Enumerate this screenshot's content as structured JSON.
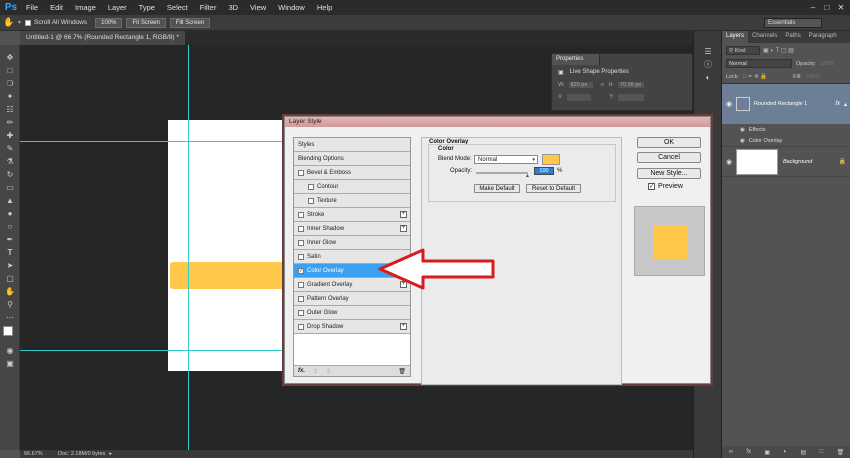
{
  "menubar": {
    "logo": "Ps",
    "items": [
      "File",
      "Edit",
      "Image",
      "Layer",
      "Type",
      "Select",
      "Filter",
      "3D",
      "View",
      "Window",
      "Help"
    ]
  },
  "options": {
    "scroll_all": "Scroll All Windows",
    "zoom100": "100%",
    "fit": "Fit Screen",
    "fill": "Fill Screen",
    "workspace": "Essentials"
  },
  "document": {
    "tab": "Untitled-1 @ 66.7% (Rounded Rectangle 1, RGB/8) *",
    "zoom": "66.67%",
    "doc_info": "Doc: 2.18M/0 bytes"
  },
  "properties": {
    "tab": "Properties",
    "title": "Live Shape Properties",
    "w_label": "W:",
    "w_value": "820 px",
    "h_label": "H:",
    "h_value": "70.99 px",
    "x_label": "X:",
    "x_value": "",
    "y_label": "Y:",
    "y_value": ""
  },
  "layers": {
    "tabs": [
      "Layers",
      "Channels",
      "Paths",
      "Paragraph"
    ],
    "kind": "Kind",
    "blend": "Normal",
    "opacity_label": "Opacity:",
    "opacity": "100%",
    "lock_label": "Lock:",
    "fill_label": "Fill:",
    "fill": "100%",
    "rows": [
      {
        "name": "Rounded Rectangle 1",
        "fx": "fx"
      },
      {
        "name": "Effects"
      },
      {
        "name": "Color Overlay"
      },
      {
        "name": "Background"
      }
    ]
  },
  "dialog": {
    "title": "Layer Style",
    "styles": [
      {
        "label": "Styles",
        "check": false,
        "plus": false,
        "indent": 0
      },
      {
        "label": "Blending Options",
        "check": false,
        "plus": false,
        "indent": 0
      },
      {
        "label": "Bevel & Emboss",
        "check": true,
        "plus": false,
        "indent": 0
      },
      {
        "label": "Contour",
        "check": true,
        "plus": false,
        "indent": 1
      },
      {
        "label": "Texture",
        "check": true,
        "plus": false,
        "indent": 1
      },
      {
        "label": "Stroke",
        "check": true,
        "plus": true,
        "indent": 0
      },
      {
        "label": "Inner Shadow",
        "check": true,
        "plus": true,
        "indent": 0
      },
      {
        "label": "Inner Glow",
        "check": true,
        "plus": false,
        "indent": 0
      },
      {
        "label": "Satin",
        "check": true,
        "plus": false,
        "indent": 0
      },
      {
        "label": "Color Overlay",
        "check": true,
        "plus": true,
        "indent": 0,
        "selected": true
      },
      {
        "label": "Gradient Overlay",
        "check": true,
        "plus": true,
        "indent": 0
      },
      {
        "label": "Pattern Overlay",
        "check": true,
        "plus": false,
        "indent": 0
      },
      {
        "label": "Outer Glow",
        "check": true,
        "plus": false,
        "indent": 0
      },
      {
        "label": "Drop Shadow",
        "check": true,
        "plus": true,
        "indent": 0
      }
    ],
    "footer_fx": "fx.",
    "section_title": "Color Overlay",
    "subsection": "Color",
    "blend_label": "Blend Mode:",
    "blend_value": "Normal",
    "opacity_label": "Opacity:",
    "opacity_value": "100",
    "opacity_unit": "%",
    "make_default": "Make Default",
    "reset_default": "Reset to Default",
    "ok": "OK",
    "cancel": "Cancel",
    "new_style": "New Style...",
    "preview": "Preview",
    "overlay_color": "#ffc84a"
  }
}
